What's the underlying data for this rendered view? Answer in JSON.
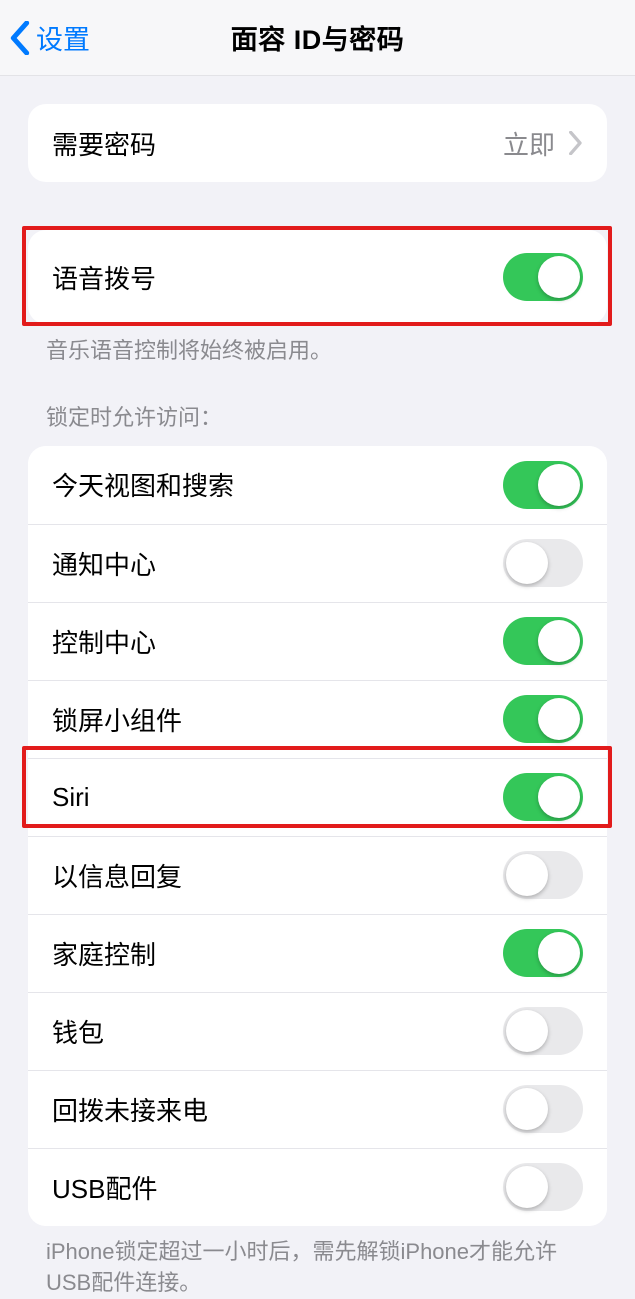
{
  "nav": {
    "back_label": "设置",
    "title": "面容 ID与密码"
  },
  "passcode": {
    "label": "需要密码",
    "value": "立即"
  },
  "voice_dial": {
    "label": "语音拨号",
    "on": true,
    "footer": "音乐语音控制将始终被启用。"
  },
  "locked_section": {
    "header": "锁定时允许访问：",
    "items": [
      {
        "label": "今天视图和搜索",
        "on": true
      },
      {
        "label": "通知中心",
        "on": false
      },
      {
        "label": "控制中心",
        "on": true
      },
      {
        "label": "锁屏小组件",
        "on": true
      },
      {
        "label": "Siri",
        "on": true
      },
      {
        "label": "以信息回复",
        "on": false
      },
      {
        "label": "家庭控制",
        "on": true
      },
      {
        "label": "钱包",
        "on": false
      },
      {
        "label": "回拨未接来电",
        "on": false
      },
      {
        "label": "USB配件",
        "on": false
      }
    ],
    "footer": "iPhone锁定超过一小时后，需先解锁iPhone才能允许USB配件连接。"
  }
}
